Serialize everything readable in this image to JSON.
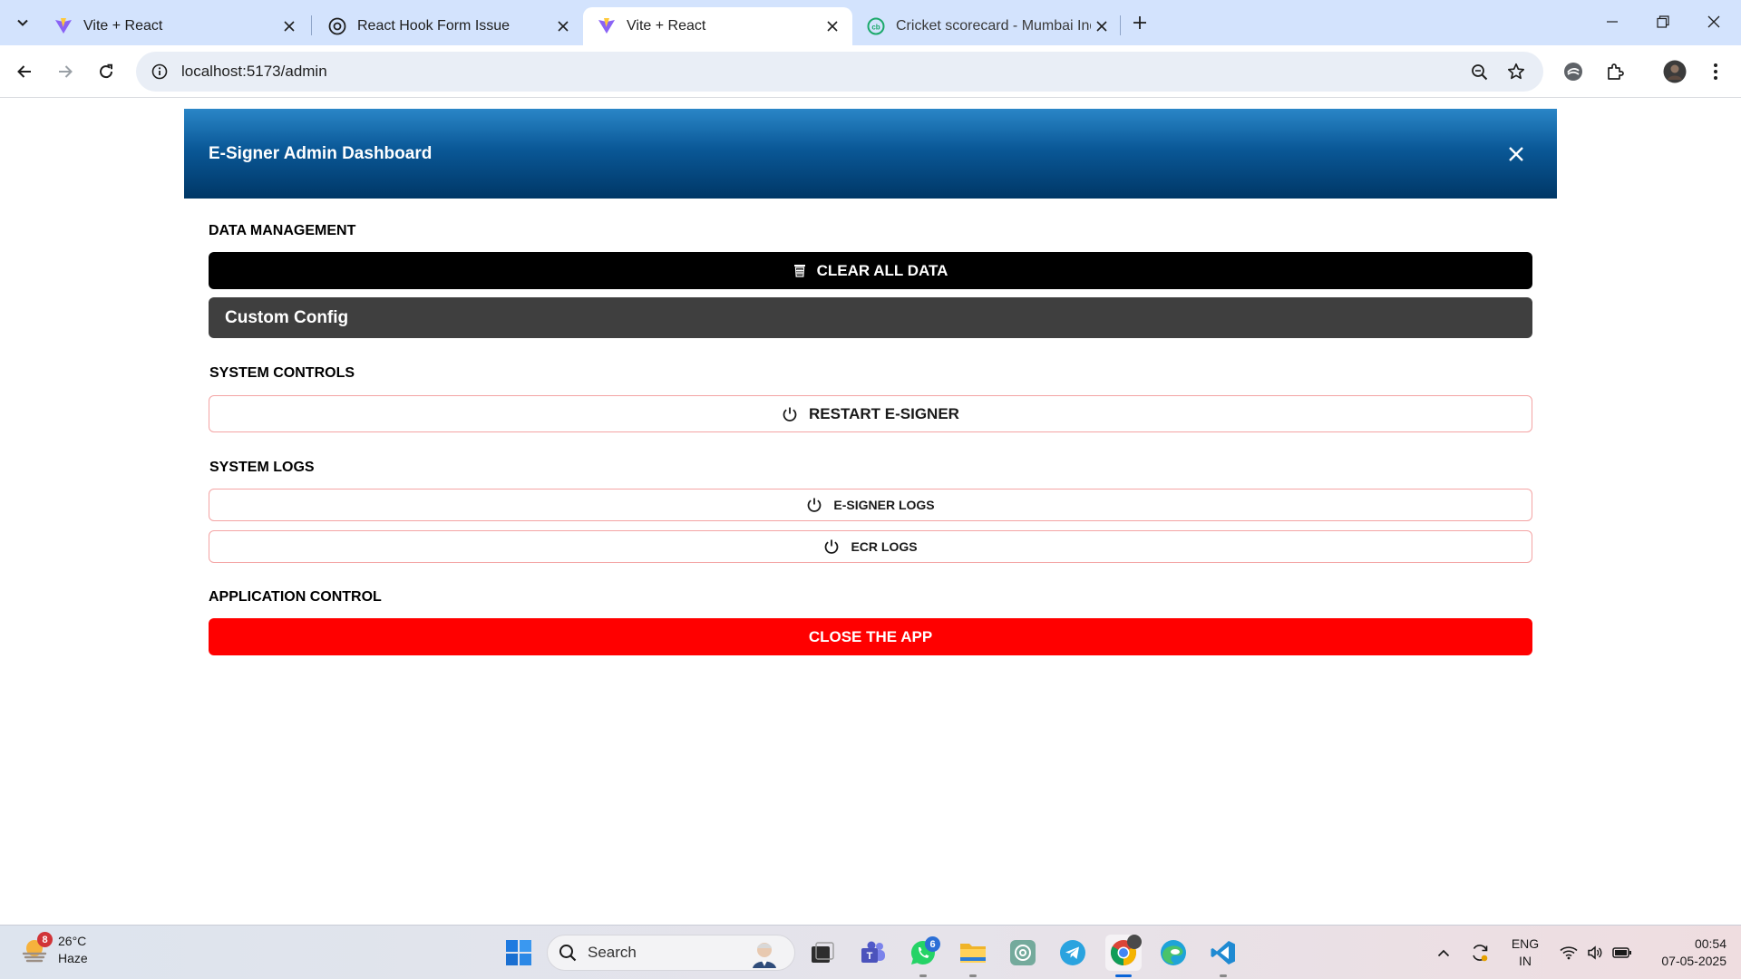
{
  "browser": {
    "tabs": [
      {
        "title": "Vite + React",
        "favicon": "vite-icon",
        "active": false
      },
      {
        "title": "React Hook Form Issue",
        "favicon": "openai-icon",
        "active": false
      },
      {
        "title": "Vite + React",
        "favicon": "vite-icon",
        "active": true
      },
      {
        "title": "Cricket scorecard - Mumbai Indi",
        "favicon": "cricbuzz-icon",
        "active": false
      }
    ],
    "url": "localhost:5173/admin"
  },
  "dashboard": {
    "title": "E-Signer Admin Dashboard",
    "sections": {
      "data_management": {
        "title": "DATA MANAGEMENT",
        "clear_label": "CLEAR ALL DATA",
        "custom_config_label": "Custom Config"
      },
      "system_controls": {
        "title": "SYSTEM CONTROLS",
        "restart_label": "RESTART E-SIGNER"
      },
      "system_logs": {
        "title": "SYSTEM LOGS",
        "esigner_logs_label": "E-SIGNER LOGS",
        "ecr_logs_label": "ECR LOGS"
      },
      "application_control": {
        "title": "APPLICATION CONTROL",
        "close_app_label": "CLOSE THE APP"
      }
    },
    "colors": {
      "header_gradient": [
        "#2a86c7",
        "#003766"
      ],
      "danger": "#ff0000",
      "dark": "#000000",
      "gray": "#3f3f3f",
      "outline": "#f4a4a4"
    }
  },
  "taskbar": {
    "weather": {
      "temp": "26°C",
      "condition": "Haze",
      "badge": "8"
    },
    "search_placeholder": "Search",
    "whatsapp_badge": "6",
    "lang_top": "ENG",
    "lang_bottom": "IN",
    "time": "00:54",
    "date": "07-05-2025"
  }
}
